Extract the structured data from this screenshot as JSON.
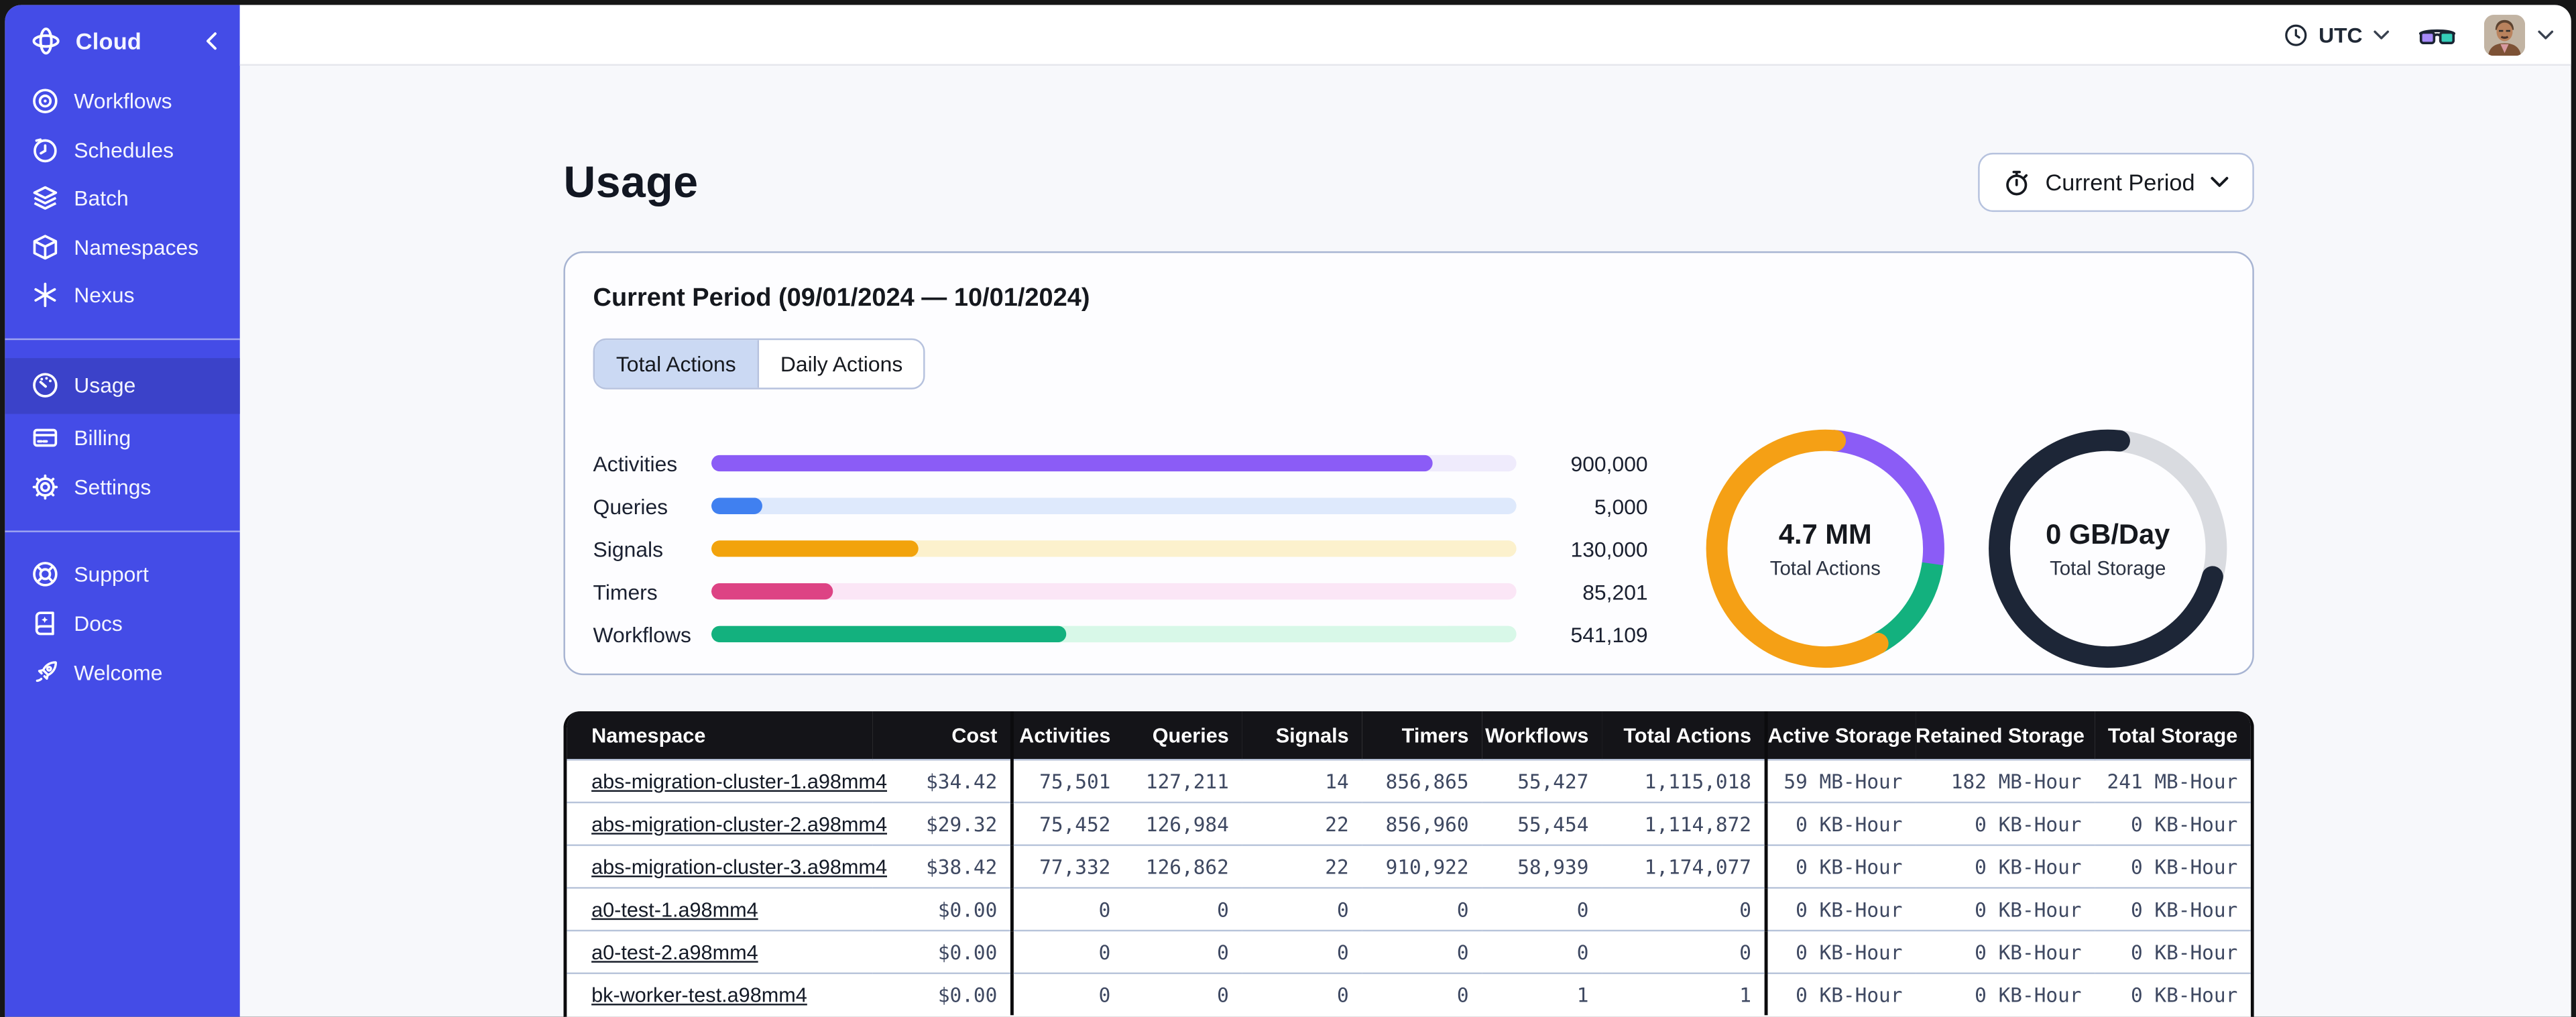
{
  "brand": {
    "name": "Cloud"
  },
  "sidebar": {
    "main": [
      {
        "label": "Workflows",
        "icon": "workflows-icon"
      },
      {
        "label": "Schedules",
        "icon": "schedules-icon"
      },
      {
        "label": "Batch",
        "icon": "batch-icon"
      },
      {
        "label": "Namespaces",
        "icon": "namespaces-icon"
      },
      {
        "label": "Nexus",
        "icon": "nexus-icon"
      }
    ],
    "account": [
      {
        "label": "Usage",
        "icon": "usage-icon",
        "active": true
      },
      {
        "label": "Billing",
        "icon": "billing-icon",
        "active": false
      },
      {
        "label": "Settings",
        "icon": "settings-icon",
        "active": false
      }
    ],
    "footer": [
      {
        "label": "Support",
        "icon": "support-icon"
      },
      {
        "label": "Docs",
        "icon": "docs-icon"
      },
      {
        "label": "Welcome",
        "icon": "welcome-icon"
      }
    ]
  },
  "topbar": {
    "timezone": "UTC"
  },
  "page": {
    "title": "Usage",
    "period_selector": "Current Period"
  },
  "usage_card": {
    "title": "Current Period (09/01/2024 — 10/01/2024)",
    "tabs": [
      {
        "label": "Total Actions",
        "selected": true
      },
      {
        "label": "Daily Actions",
        "selected": false
      }
    ]
  },
  "chart_data": [
    {
      "type": "bar",
      "orientation": "horizontal",
      "categories": [
        "Activities",
        "Queries",
        "Signals",
        "Timers",
        "Workflows"
      ],
      "values": [
        900000,
        5000,
        130000,
        85201,
        541109
      ],
      "value_labels": [
        "900,000",
        "5,000",
        "130,000",
        "85,201",
        "541,109"
      ],
      "fill_pcts": [
        89.5,
        6.4,
        25.8,
        15.2,
        44
      ],
      "colors": [
        "#8B5CF6",
        "#4080F0",
        "#F2A30C",
        "#DD4384",
        "#13B17E"
      ],
      "track_colors": [
        "#EFEBFC",
        "#DEE9FC",
        "#FCF1CD",
        "#FBE6F6",
        "#D8F8E8"
      ],
      "grid": false,
      "legend": "none"
    },
    {
      "type": "donut",
      "center_value": "4.7 MM",
      "center_label": "Total Actions",
      "segments": [
        {
          "name": "activities",
          "color": "#8B5CF6",
          "pct": 26.2,
          "start_deg": 4,
          "cap": "butt"
        },
        {
          "name": "workflows",
          "color": "#13B17E",
          "pct": 14.8,
          "start_deg": 98,
          "cap": "butt"
        },
        {
          "name": "other",
          "color": "#F5A015",
          "pct": 59.5,
          "start_deg": 151,
          "cap": "round"
        }
      ]
    },
    {
      "type": "donut",
      "center_value": "0 GB/Day",
      "center_label": "Total Storage",
      "segments": [
        {
          "name": "remaining",
          "color": "#D9DBE0",
          "pct": 100,
          "start_deg": 0,
          "cap": "butt"
        },
        {
          "name": "used",
          "color": "#1D2637",
          "pct": 72.5,
          "start_deg": 105,
          "cap": "round"
        }
      ]
    }
  ],
  "table": {
    "columns": [
      "Namespace",
      "Cost",
      "Activities",
      "Queries",
      "Signals",
      "Timers",
      "Workflows",
      "Total Actions",
      "Active Storage",
      "Retained Storage",
      "Total Storage"
    ],
    "rows": [
      [
        "abs-migration-cluster-1.a98mm4",
        "$34.42",
        "75,501",
        "127,211",
        "14",
        "856,865",
        "55,427",
        "1,115,018",
        "59 MB-Hour",
        "182 MB-Hour",
        "241 MB-Hour"
      ],
      [
        "abs-migration-cluster-2.a98mm4",
        "$29.32",
        "75,452",
        "126,984",
        "22",
        "856,960",
        "55,454",
        "1,114,872",
        "0 KB-Hour",
        "0 KB-Hour",
        "0 KB-Hour"
      ],
      [
        "abs-migration-cluster-3.a98mm4",
        "$38.42",
        "77,332",
        "126,862",
        "22",
        "910,922",
        "58,939",
        "1,174,077",
        "0 KB-Hour",
        "0 KB-Hour",
        "0 KB-Hour"
      ],
      [
        "a0-test-1.a98mm4",
        "$0.00",
        "0",
        "0",
        "0",
        "0",
        "0",
        "0",
        "0 KB-Hour",
        "0 KB-Hour",
        "0 KB-Hour"
      ],
      [
        "a0-test-2.a98mm4",
        "$0.00",
        "0",
        "0",
        "0",
        "0",
        "0",
        "0",
        "0 KB-Hour",
        "0 KB-Hour",
        "0 KB-Hour"
      ],
      [
        "bk-worker-test.a98mm4",
        "$0.00",
        "0",
        "0",
        "0",
        "0",
        "1",
        "1",
        "0 KB-Hour",
        "0 KB-Hour",
        "0 KB-Hour"
      ]
    ]
  }
}
